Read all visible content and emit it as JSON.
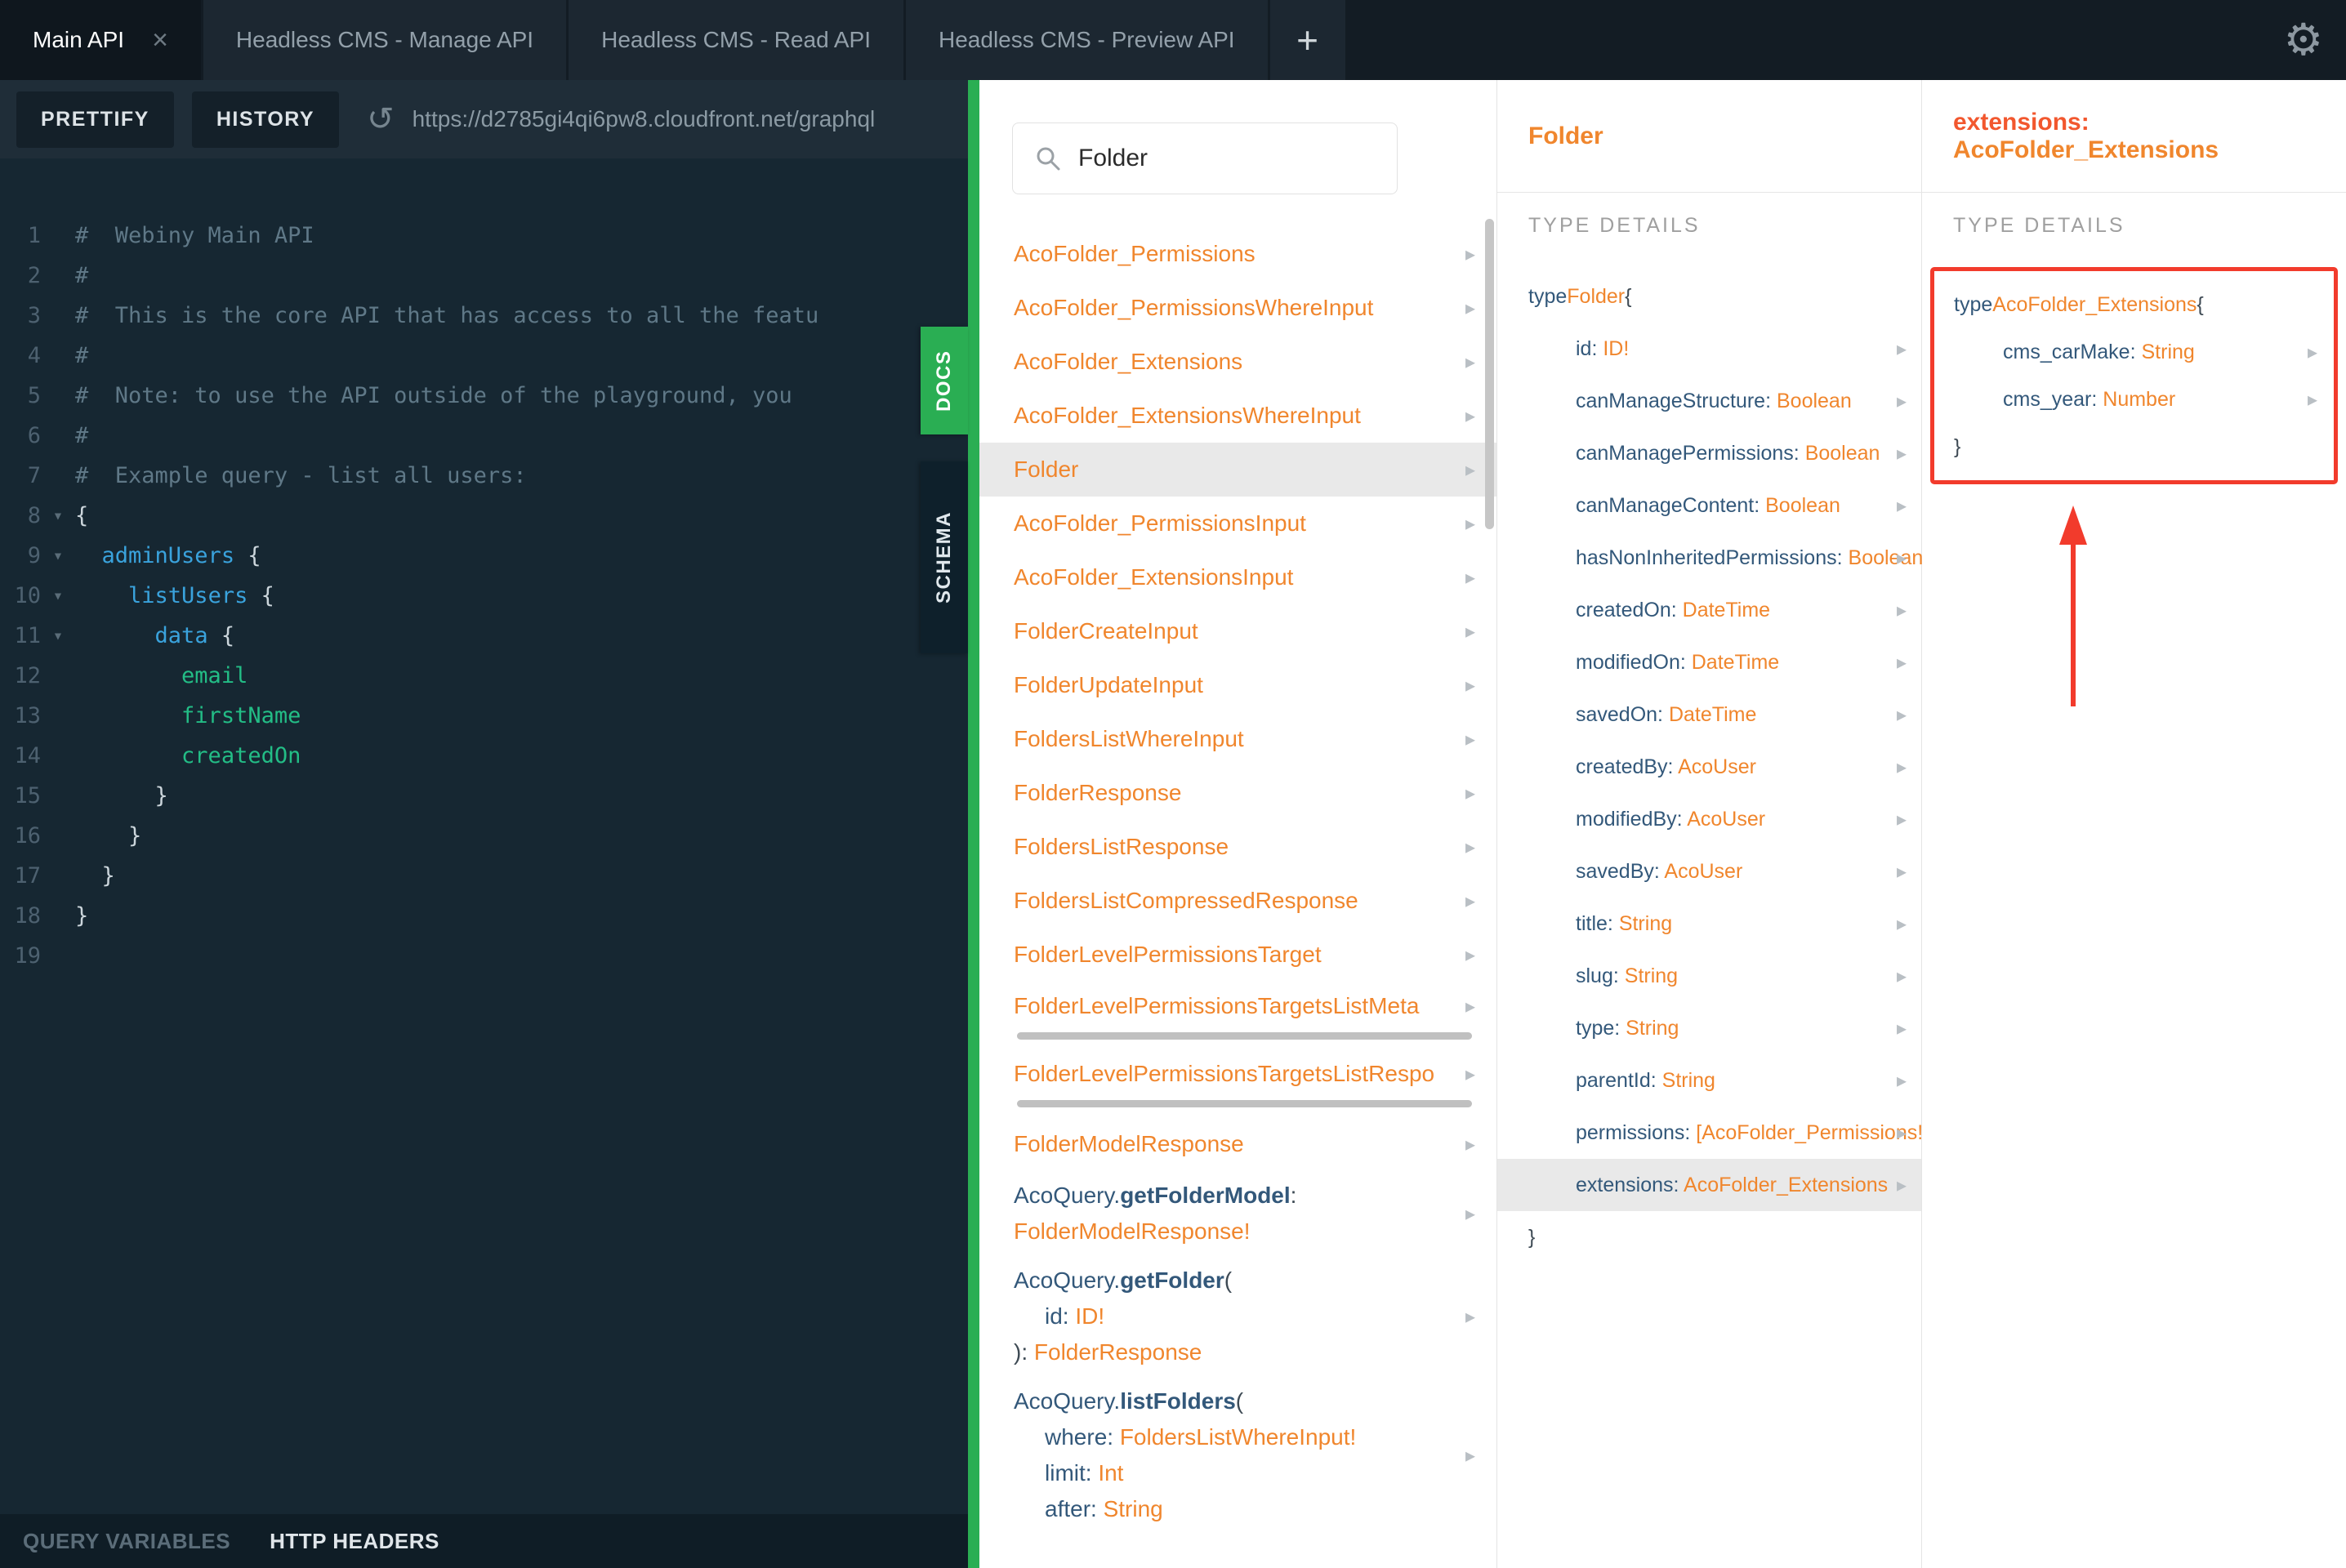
{
  "icons": {
    "close": "×",
    "add_tab": "+",
    "settings_gear": "⚙",
    "reload": "↺",
    "chevron_right": "▸",
    "fold_down": "▾"
  },
  "colors": {
    "accent_green": "#2AAE53",
    "type_orange": "#F0862D",
    "field_navy": "#33587A",
    "annotation_red": "#F23B2C"
  },
  "tabbar": {
    "tabs": [
      {
        "label": "Main API",
        "active": true,
        "closable": true
      },
      {
        "label": "Headless CMS - Manage API"
      },
      {
        "label": "Headless CMS - Read API"
      },
      {
        "label": "Headless CMS - Preview API"
      }
    ],
    "add_label": "+"
  },
  "toolbar": {
    "prettify": "PRETTIFY",
    "history": "HISTORY",
    "url": "https://d2785gi4qi6pw8.cloudfront.net/graphql"
  },
  "editor": {
    "lines": [
      {
        "n": 1,
        "segs": [
          {
            "t": "#  Webiny Main API",
            "c": "com"
          }
        ]
      },
      {
        "n": 2,
        "segs": [
          {
            "t": "#",
            "c": "com"
          }
        ]
      },
      {
        "n": 3,
        "segs": [
          {
            "t": "#  This is the core API that has access to all the featu",
            "c": "com"
          }
        ]
      },
      {
        "n": 4,
        "segs": [
          {
            "t": "#",
            "c": "com"
          }
        ]
      },
      {
        "n": 5,
        "segs": [
          {
            "t": "#  Note: to use the API outside of the playground, you",
            "c": "com"
          }
        ]
      },
      {
        "n": 6,
        "segs": [
          {
            "t": "#",
            "c": "com"
          }
        ]
      },
      {
        "n": 7,
        "segs": [
          {
            "t": "#  Example query - list all users:",
            "c": "com"
          }
        ]
      },
      {
        "n": 8,
        "fold": true,
        "segs": [
          {
            "t": "{",
            "c": "p"
          }
        ]
      },
      {
        "n": 9,
        "fold": true,
        "segs": [
          {
            "t": "  ",
            "c": "p"
          },
          {
            "t": "adminUsers",
            "c": "prop"
          },
          {
            "t": " {",
            "c": "p"
          }
        ]
      },
      {
        "n": 10,
        "fold": true,
        "segs": [
          {
            "t": "    ",
            "c": "p"
          },
          {
            "t": "listUsers",
            "c": "prop"
          },
          {
            "t": " {",
            "c": "p"
          }
        ]
      },
      {
        "n": 11,
        "fold": true,
        "segs": [
          {
            "t": "      ",
            "c": "p"
          },
          {
            "t": "data",
            "c": "prop"
          },
          {
            "t": " {",
            "c": "p"
          }
        ]
      },
      {
        "n": 12,
        "segs": [
          {
            "t": "        ",
            "c": "p"
          },
          {
            "t": "email",
            "c": "leaf"
          }
        ]
      },
      {
        "n": 13,
        "segs": [
          {
            "t": "        ",
            "c": "p"
          },
          {
            "t": "firstName",
            "c": "leaf"
          }
        ]
      },
      {
        "n": 14,
        "segs": [
          {
            "t": "        ",
            "c": "p"
          },
          {
            "t": "createdOn",
            "c": "leaf"
          }
        ]
      },
      {
        "n": 15,
        "segs": [
          {
            "t": "      }",
            "c": "p"
          }
        ]
      },
      {
        "n": 16,
        "segs": [
          {
            "t": "    }",
            "c": "p"
          }
        ]
      },
      {
        "n": 17,
        "segs": [
          {
            "t": "  }",
            "c": "p"
          }
        ]
      },
      {
        "n": 18,
        "segs": [
          {
            "t": "}",
            "c": "p"
          }
        ]
      },
      {
        "n": 19,
        "segs": []
      }
    ]
  },
  "footer": {
    "query_variables": "QUERY VARIABLES",
    "http_headers": "HTTP HEADERS"
  },
  "side_tabs": {
    "docs": "DOCS",
    "schema": "SCHEMA"
  },
  "docs": {
    "search": {
      "value": "Folder"
    },
    "results": [
      {
        "lines": [
          {
            "segs": [
              {
                "t": "AcoFolder_Permissions",
                "c": "type"
              }
            ]
          }
        ]
      },
      {
        "lines": [
          {
            "segs": [
              {
                "t": "AcoFolder_PermissionsWhereInput",
                "c": "type"
              }
            ]
          }
        ]
      },
      {
        "lines": [
          {
            "segs": [
              {
                "t": "AcoFolder_Extensions",
                "c": "type"
              }
            ]
          }
        ]
      },
      {
        "lines": [
          {
            "segs": [
              {
                "t": "AcoFolder_ExtensionsWhereInput",
                "c": "type"
              }
            ]
          }
        ]
      },
      {
        "sel": true,
        "lines": [
          {
            "segs": [
              {
                "t": "Folder",
                "c": "type"
              }
            ]
          }
        ]
      },
      {
        "lines": [
          {
            "segs": [
              {
                "t": "AcoFolder_PermissionsInput",
                "c": "type"
              }
            ]
          }
        ]
      },
      {
        "lines": [
          {
            "segs": [
              {
                "t": "AcoFolder_ExtensionsInput",
                "c": "type"
              }
            ]
          }
        ]
      },
      {
        "lines": [
          {
            "segs": [
              {
                "t": "FolderCreateInput",
                "c": "type"
              }
            ]
          }
        ]
      },
      {
        "lines": [
          {
            "segs": [
              {
                "t": "FolderUpdateInput",
                "c": "type"
              }
            ]
          }
        ]
      },
      {
        "lines": [
          {
            "segs": [
              {
                "t": "FoldersListWhereInput",
                "c": "type"
              }
            ]
          }
        ]
      },
      {
        "lines": [
          {
            "segs": [
              {
                "t": "FolderResponse",
                "c": "type"
              }
            ]
          }
        ]
      },
      {
        "lines": [
          {
            "segs": [
              {
                "t": "FoldersListResponse",
                "c": "type"
              }
            ]
          }
        ]
      },
      {
        "lines": [
          {
            "segs": [
              {
                "t": "FoldersListCompressedResponse",
                "c": "type"
              }
            ]
          }
        ]
      },
      {
        "lines": [
          {
            "segs": [
              {
                "t": "FolderLevelPermissionsTarget",
                "c": "type"
              }
            ]
          }
        ]
      },
      {
        "hscroll": true,
        "lines": [
          {
            "segs": [
              {
                "t": "FolderLevelPermissionsTargetsListMeta",
                "c": "type"
              }
            ]
          }
        ]
      },
      {
        "hscroll": true,
        "lines": [
          {
            "segs": [
              {
                "t": "FolderLevelPermissionsTargetsListRespo",
                "c": "type"
              }
            ]
          }
        ]
      },
      {
        "lines": [
          {
            "segs": [
              {
                "t": "FolderModelResponse",
                "c": "type"
              }
            ]
          }
        ]
      },
      {
        "lines": [
          {
            "segs": [
              {
                "t": "AcoQuery.",
                "c": "field"
              },
              {
                "t": "getFolderModel",
                "c": "fieldb"
              },
              {
                "t": ":",
                "c": "p"
              }
            ]
          },
          {
            "segs": [
              {
                "t": "FolderModelResponse!",
                "c": "type"
              }
            ]
          }
        ]
      },
      {
        "lines": [
          {
            "segs": [
              {
                "t": "AcoQuery.",
                "c": "field"
              },
              {
                "t": "getFolder",
                "c": "fieldb"
              },
              {
                "t": "(",
                "c": "p"
              }
            ]
          },
          {
            "ind": true,
            "segs": [
              {
                "t": "id: ",
                "c": "field"
              },
              {
                "t": "ID!",
                "c": "type"
              }
            ]
          },
          {
            "segs": [
              {
                "t": "): ",
                "c": "p"
              },
              {
                "t": "FolderResponse",
                "c": "type"
              }
            ]
          }
        ]
      },
      {
        "lines": [
          {
            "segs": [
              {
                "t": "AcoQuery.",
                "c": "field"
              },
              {
                "t": "listFolders",
                "c": "fieldb"
              },
              {
                "t": "(",
                "c": "p"
              }
            ]
          },
          {
            "ind": true,
            "segs": [
              {
                "t": "where: ",
                "c": "field"
              },
              {
                "t": "FoldersListWhereInput!",
                "c": "type"
              }
            ]
          },
          {
            "ind": true,
            "segs": [
              {
                "t": "limit: ",
                "c": "field"
              },
              {
                "t": "Int",
                "c": "type"
              }
            ]
          },
          {
            "ind": true,
            "segs": [
              {
                "t": "after: ",
                "c": "field"
              },
              {
                "t": "String",
                "c": "type"
              }
            ]
          }
        ]
      }
    ]
  },
  "type_panel": {
    "title": "Folder",
    "section": "TYPE DETAILS",
    "open": [
      {
        "t": "type ",
        "c": "field"
      },
      {
        "t": "Folder",
        "c": "type"
      },
      {
        "t": " {",
        "c": "p"
      }
    ],
    "fields": [
      {
        "name": "id:",
        "type": "ID!"
      },
      {
        "name": "canManageStructure:",
        "type": "Boolean"
      },
      {
        "name": "canManagePermissions:",
        "type": "Boolean"
      },
      {
        "name": "canManageContent:",
        "type": "Boolean"
      },
      {
        "name": "hasNonInheritedPermissions:",
        "type": "Boolean",
        "wrap": true
      },
      {
        "name": "createdOn:",
        "type": "DateTime"
      },
      {
        "name": "modifiedOn:",
        "type": "DateTime"
      },
      {
        "name": "savedOn:",
        "type": "DateTime"
      },
      {
        "name": "createdBy:",
        "type": "AcoUser"
      },
      {
        "name": "modifiedBy:",
        "type": "AcoUser"
      },
      {
        "name": "savedBy:",
        "type": "AcoUser"
      },
      {
        "name": "title:",
        "type": "String"
      },
      {
        "name": "slug:",
        "type": "String"
      },
      {
        "name": "type:",
        "type": "String"
      },
      {
        "name": "parentId:",
        "type": "String"
      },
      {
        "name": "permissions:",
        "type": "[AcoFolder_Permissions!]",
        "wrap": true
      },
      {
        "name": "extensions:",
        "type": "AcoFolder_Extensions",
        "sel": true
      }
    ],
    "close": "}"
  },
  "field_panel": {
    "title": [
      {
        "t": "extensions: ",
        "c": "hf"
      },
      {
        "t": "AcoFolder_Extensions",
        "c": "ht"
      }
    ],
    "section": "TYPE DETAILS",
    "open": [
      {
        "t": "type ",
        "c": "field"
      },
      {
        "t": "AcoFolder_Extensions",
        "c": "type"
      },
      {
        "t": " {",
        "c": "p"
      }
    ],
    "fields": [
      {
        "name": "cms_carMake:",
        "type": "String"
      },
      {
        "name": "cms_year:",
        "type": "Number"
      }
    ],
    "close": "}"
  }
}
